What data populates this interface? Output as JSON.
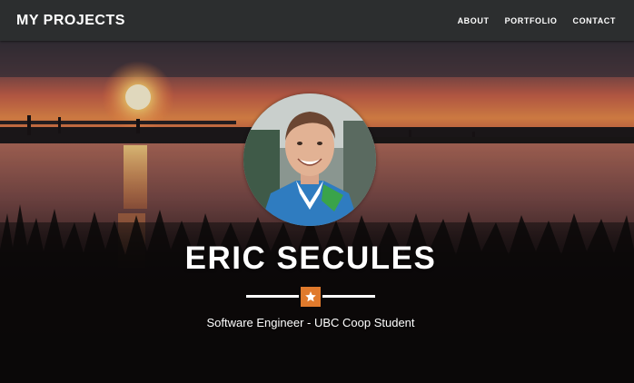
{
  "navbar": {
    "brand": "MY PROJECTS",
    "links": [
      {
        "label": "ABOUT"
      },
      {
        "label": "PORTFOLIO"
      },
      {
        "label": "CONTACT"
      }
    ]
  },
  "hero": {
    "name": "ERIC SECULES",
    "subtitle": "Software Engineer - UBC Coop Student",
    "divider_icon": "star-icon",
    "accent_color": "#e07a2c"
  }
}
